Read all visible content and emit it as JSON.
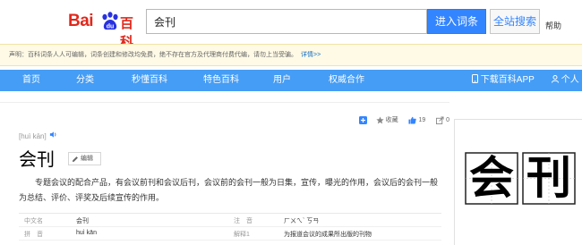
{
  "header": {
    "logo_text_bai": "Bai",
    "logo_text_baike": "百科",
    "search_value": "会刊",
    "enter_button": "进入词条",
    "site_search_button": "全站搜索",
    "help_link": "帮助"
  },
  "notice": {
    "text": "声明：百科词条人人可编辑，词条创建和修改均免费，绝不存在官方及代理商付费代编，请勿上当受骗。",
    "link": "详情>>"
  },
  "nav": {
    "items": [
      "首页",
      "分类",
      "秒懂百科",
      "特色百科",
      "用户",
      "权威合作"
    ],
    "app_download": "下载百科APP",
    "personal": "个人中"
  },
  "toolbar": {
    "add_icon": "plus-square-icon",
    "favorite_label": "收藏",
    "like_count": "19",
    "share_count": "0"
  },
  "entry": {
    "pinyin": "[huì kān]",
    "title": "会刊",
    "edit_label": "编辑",
    "summary": "专题会议的配合产品，有会议前刊和会议后刊，会议前的会刊一般为日集，宣传，曝光的作用，会议后的会刊一般为总结、评价、评奖及后续宣传的作用。",
    "info": [
      {
        "k1": "中文名",
        "v1": "会刊",
        "k2": "注　音",
        "v2": "ㄏㄨㄟˋ ㄎㄢ"
      },
      {
        "k1": "拼　音",
        "v1": "huì kān",
        "k2": "解释1",
        "v2": "为报道会议的成果所出版的刊物"
      }
    ]
  },
  "side_image": {
    "chars": [
      "会",
      "刊"
    ]
  },
  "colors": {
    "accent": "#3385ff",
    "nav_bg": "#459df5",
    "brand_red": "#e1281c",
    "notice_bg": "#fffae6"
  }
}
